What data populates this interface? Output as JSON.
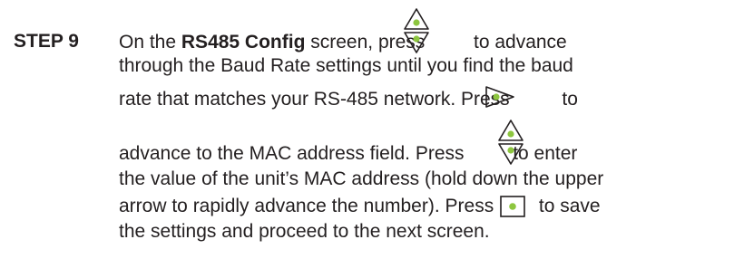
{
  "step": {
    "label": "STEP 9",
    "lines": {
      "l1a": "On the ",
      "l1b": "RS485 Config",
      "l1c": " screen, press ",
      "l1d": " to advance",
      "l2": "through the Baud Rate settings until you find the baud",
      "l3a": "rate that matches your RS-485 network. Press ",
      "l3b": " to",
      "l4a": "advance to the MAC address field. Press ",
      "l4b": " to enter",
      "l5": "the value of the unit’s MAC address (hold down the upper",
      "l6a": "arrow to rapidly advance the number). Press ",
      "l6b": " to save",
      "l7": "the settings and proceed to the next screen."
    }
  },
  "icons": {
    "up_down": "up-down-arrow-button-icon",
    "right": "right-arrow-button-icon",
    "enter": "enter-button-icon",
    "accent_color": "#8dc63f",
    "outline_color": "#231f20"
  }
}
